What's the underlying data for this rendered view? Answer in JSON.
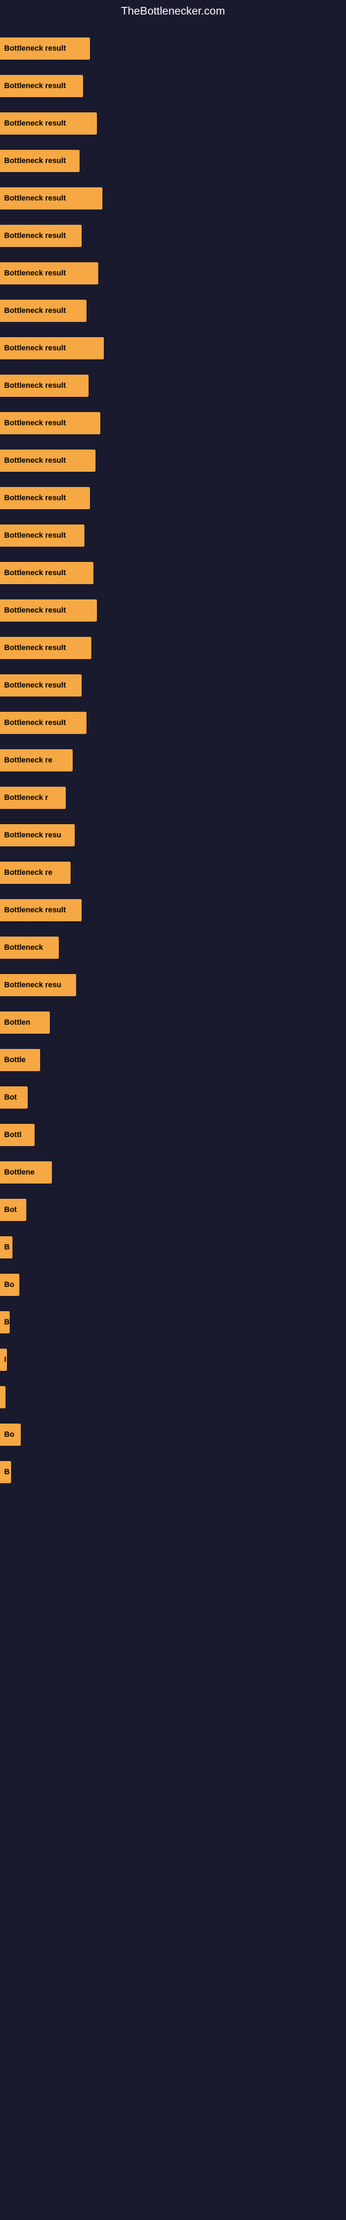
{
  "site": {
    "title": "TheBottlenecker.com"
  },
  "bars": [
    {
      "label": "Bottleneck result",
      "width": 130
    },
    {
      "label": "Bottleneck result",
      "width": 120
    },
    {
      "label": "Bottleneck result",
      "width": 140
    },
    {
      "label": "Bottleneck result",
      "width": 115
    },
    {
      "label": "Bottleneck result",
      "width": 148
    },
    {
      "label": "Bottleneck result",
      "width": 118
    },
    {
      "label": "Bottleneck result",
      "width": 142
    },
    {
      "label": "Bottleneck result",
      "width": 125
    },
    {
      "label": "Bottleneck result",
      "width": 150
    },
    {
      "label": "Bottleneck result",
      "width": 128
    },
    {
      "label": "Bottleneck result",
      "width": 145
    },
    {
      "label": "Bottleneck result",
      "width": 138
    },
    {
      "label": "Bottleneck result",
      "width": 130
    },
    {
      "label": "Bottleneck result",
      "width": 122
    },
    {
      "label": "Bottleneck result",
      "width": 135
    },
    {
      "label": "Bottleneck result",
      "width": 140
    },
    {
      "label": "Bottleneck result",
      "width": 132
    },
    {
      "label": "Bottleneck result",
      "width": 118
    },
    {
      "label": "Bottleneck result",
      "width": 125
    },
    {
      "label": "Bottleneck re",
      "width": 105
    },
    {
      "label": "Bottleneck r",
      "width": 95
    },
    {
      "label": "Bottleneck resu",
      "width": 108
    },
    {
      "label": "Bottleneck re",
      "width": 102
    },
    {
      "label": "Bottleneck result",
      "width": 118
    },
    {
      "label": "Bottleneck",
      "width": 85
    },
    {
      "label": "Bottleneck resu",
      "width": 110
    },
    {
      "label": "Bottlen",
      "width": 72
    },
    {
      "label": "Bottle",
      "width": 58
    },
    {
      "label": "Bot",
      "width": 40
    },
    {
      "label": "Bottl",
      "width": 50
    },
    {
      "label": "Bottlene",
      "width": 75
    },
    {
      "label": "Bot",
      "width": 38
    },
    {
      "label": "B",
      "width": 18
    },
    {
      "label": "Bo",
      "width": 28
    },
    {
      "label": "B",
      "width": 14
    },
    {
      "label": "I",
      "width": 10
    },
    {
      "label": "",
      "width": 8
    },
    {
      "label": "Bo",
      "width": 30
    },
    {
      "label": "B",
      "width": 16
    }
  ]
}
